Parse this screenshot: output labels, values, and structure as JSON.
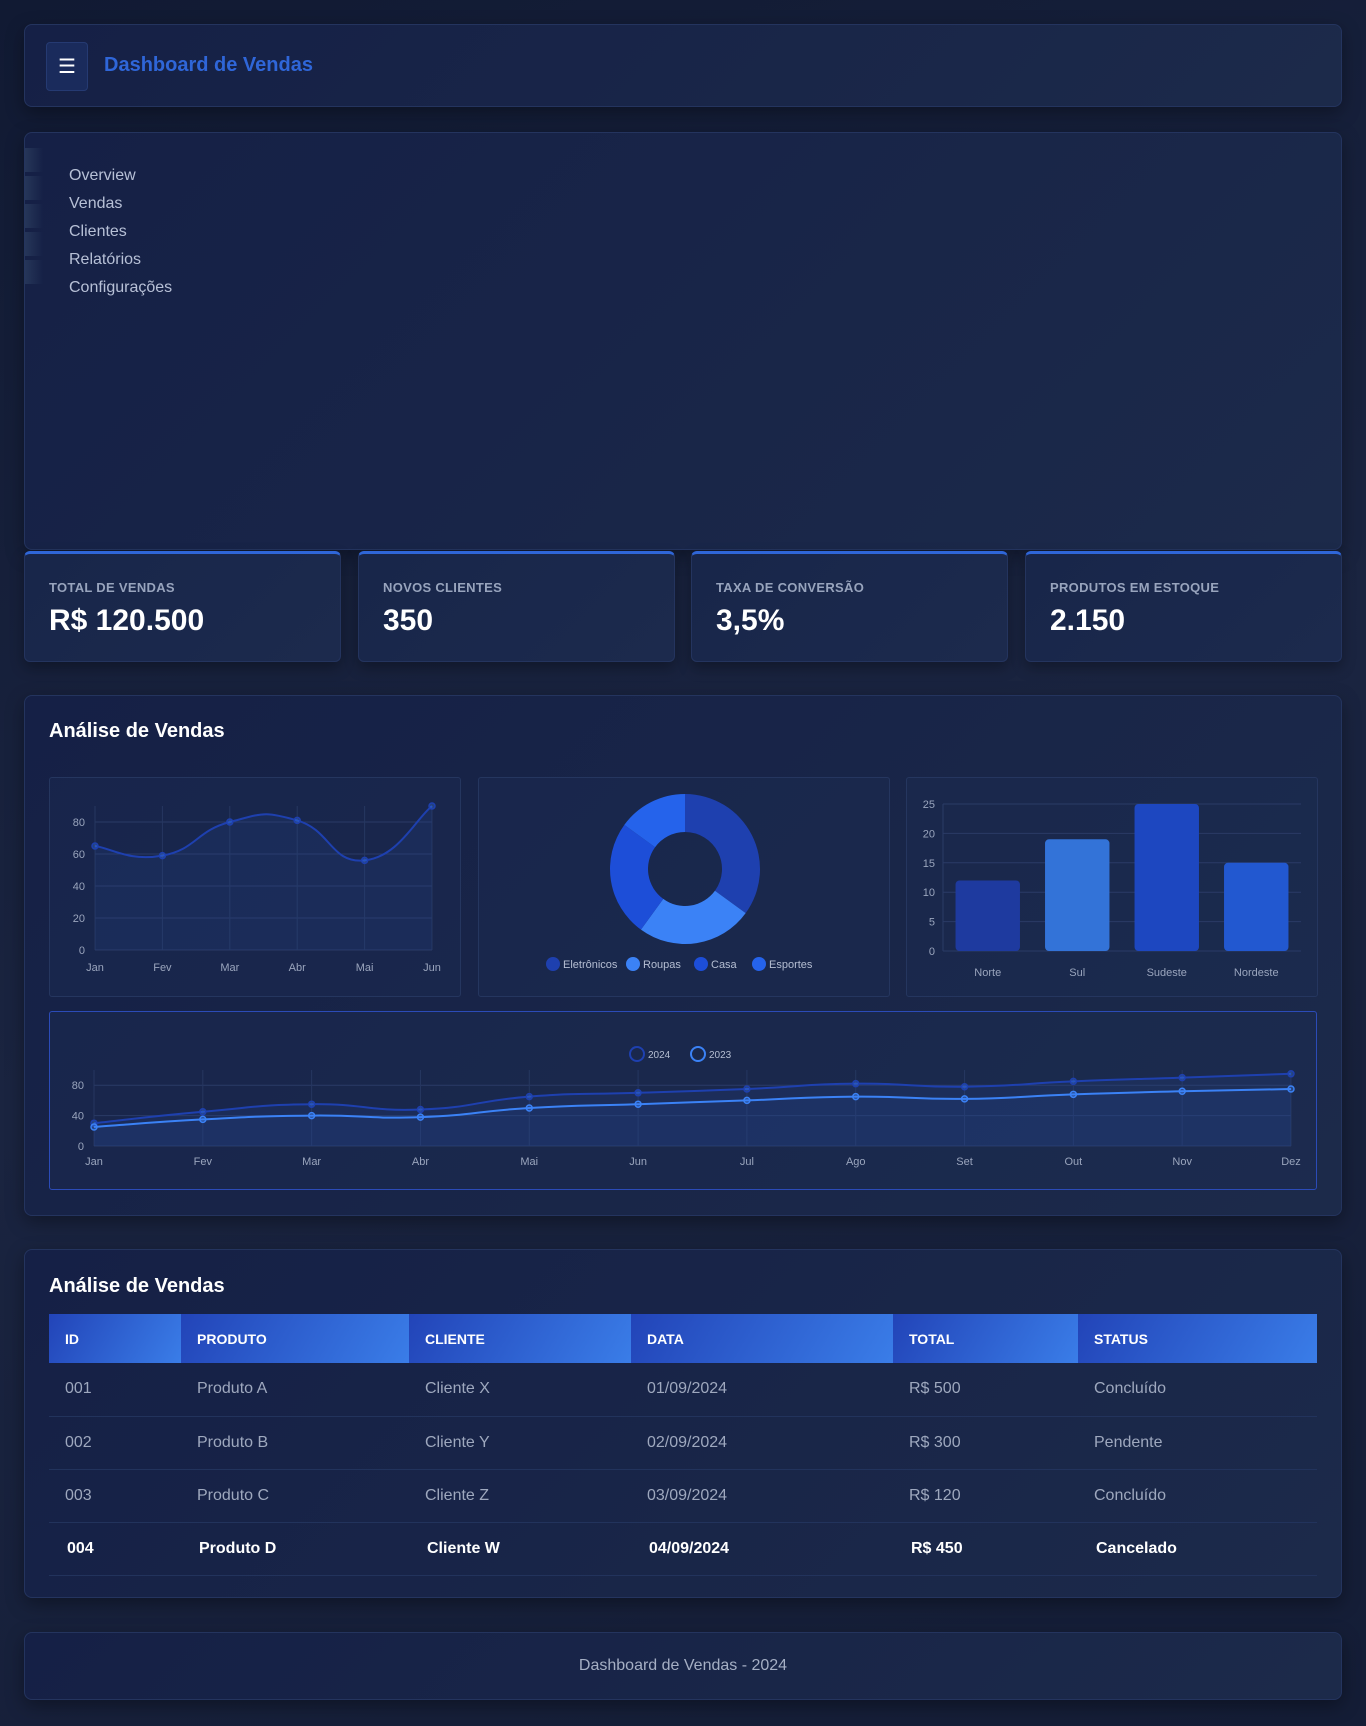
{
  "header": {
    "title": "Dashboard de Vendas",
    "menu_icon": "hamburger-icon",
    "menu_glyph": "☰"
  },
  "nav": {
    "items": [
      "Overview",
      "Vendas",
      "Clientes",
      "Relatórios",
      "Configurações"
    ]
  },
  "stats": [
    {
      "label": "TOTAL DE VENDAS",
      "value": "R$ 120.500"
    },
    {
      "label": "NOVOS CLIENTES",
      "value": "350"
    },
    {
      "label": "TAXA DE CONVERSÃO",
      "value": "3,5%"
    },
    {
      "label": "PRODUTOS EM ESTOQUE",
      "value": "2.150"
    }
  ],
  "analysis": {
    "title": "Análise de Vendas"
  },
  "colors": {
    "accent": "#2f66d8",
    "line1": "#1e40af",
    "line2": "#3b82f6"
  },
  "chart_data": [
    {
      "type": "line",
      "categories": [
        "Jan",
        "Fev",
        "Mar",
        "Abr",
        "Mai",
        "Jun"
      ],
      "values": [
        65,
        59,
        80,
        81,
        56,
        90
      ],
      "ylim": [
        0,
        90
      ],
      "yticks": [
        0,
        20,
        40,
        60,
        80
      ],
      "grid": true,
      "color": "#1e40af"
    },
    {
      "type": "pie",
      "donut": true,
      "categories": [
        "Eletrônicos",
        "Roupas",
        "Casa",
        "Esportes"
      ],
      "values": [
        35,
        25,
        25,
        15
      ],
      "colors": [
        "#1e40af",
        "#3b82f6",
        "#1d4ed8",
        "#2563eb"
      ],
      "legend": "bottom"
    },
    {
      "type": "bar",
      "categories": [
        "Norte",
        "Sul",
        "Sudeste",
        "Nordeste"
      ],
      "values": [
        12,
        19,
        25,
        15
      ],
      "ylim": [
        0,
        25
      ],
      "yticks": [
        0,
        5,
        10,
        15,
        20,
        25
      ],
      "colors": [
        "#1e3a9f",
        "#3373d8",
        "#1d47c0",
        "#2258d0"
      ],
      "grid": true
    },
    {
      "type": "line",
      "categories": [
        "Jan",
        "Fev",
        "Mar",
        "Abr",
        "Mai",
        "Jun",
        "Jul",
        "Ago",
        "Set",
        "Out",
        "Nov",
        "Dez"
      ],
      "series": [
        {
          "name": "2024",
          "values": [
            30,
            45,
            55,
            48,
            65,
            70,
            75,
            82,
            78,
            85,
            90,
            95
          ],
          "color": "#1e40af"
        },
        {
          "name": "2023",
          "values": [
            25,
            35,
            40,
            38,
            50,
            55,
            60,
            65,
            62,
            68,
            72,
            75
          ],
          "color": "#3b82f6"
        }
      ],
      "ylim": [
        0,
        100
      ],
      "yticks": [
        0,
        40,
        80
      ],
      "grid": true,
      "legend": "top"
    }
  ],
  "table": {
    "title": "Análise de Vendas",
    "columns": [
      "ID",
      "PRODUTO",
      "CLIENTE",
      "DATA",
      "TOTAL",
      "STATUS"
    ],
    "rows": [
      [
        "001",
        "Produto A",
        "Cliente X",
        "01/09/2024",
        "R$ 500",
        "Concluído"
      ],
      [
        "002",
        "Produto B",
        "Cliente Y",
        "02/09/2024",
        "R$ 300",
        "Pendente"
      ],
      [
        "003",
        "Produto C",
        "Cliente Z",
        "03/09/2024",
        "R$ 120",
        "Concluído"
      ],
      [
        "004",
        "Produto D",
        "Cliente W",
        "04/09/2024",
        "R$ 450",
        "Cancelado"
      ]
    ]
  },
  "footer": {
    "text": "Dashboard de Vendas - 2024"
  }
}
